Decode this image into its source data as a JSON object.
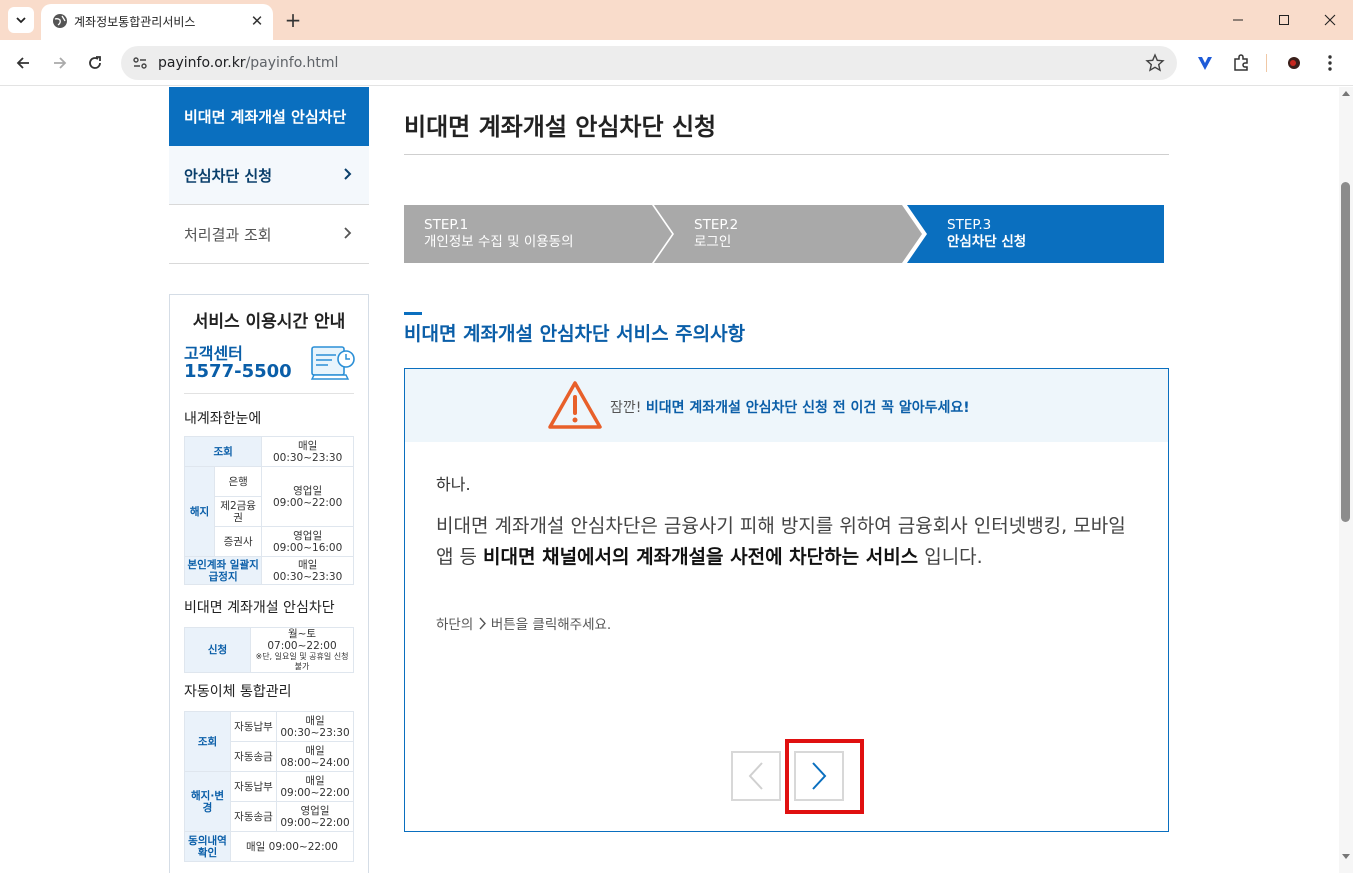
{
  "browser": {
    "tab_title": "계좌정보통합관리서비스",
    "url_host": "payinfo.or.kr",
    "url_path": "/payinfo.html"
  },
  "sidebar": {
    "header": "비대면 계좌개설 안심차단",
    "items": [
      {
        "label": "안심차단 신청",
        "active": true
      },
      {
        "label": "처리결과 조회",
        "active": false
      }
    ],
    "service_hours": {
      "title": "서비스 이용시간 안내",
      "cs_label": "고객센터",
      "cs_number": "1577-5500",
      "sections": {
        "my_account": "내계좌한눈에",
        "nonface": "비대면 계좌개설 안심차단",
        "autopay": "자동이체 통합관리"
      },
      "my_account_table": {
        "inquiry": "조회",
        "inquiry_time": "매일 00:30~23:30",
        "terminate": "해지",
        "bank": "은행",
        "second_fin": "제2금융권",
        "bank_time": "영업일 09:00~22:00",
        "securities": "증권사",
        "securities_time": "영업일 09:00~16:00",
        "suspend": "본인계좌 일괄지급정지",
        "suspend_time": "매일 00:30~23:30"
      },
      "nonface_table": {
        "apply": "신청",
        "apply_time": "월~토 07:00~22:00",
        "apply_note": "※단, 일요일 및 공휴일 신청 불가"
      },
      "autopay_table": {
        "inquiry": "조회",
        "auto_pay": "자동납부",
        "auto_send": "자동송금",
        "inq_pay_time": "매일 00:30~23:30",
        "inq_send_time": "매일 08:00~24:00",
        "change": "해지·변경",
        "chg_pay_time": "매일 09:00~22:00",
        "chg_send_time": "영업일 09:00~22:00",
        "consent": "동의내역 확인",
        "consent_time": "매일 09:00~22:00"
      }
    }
  },
  "main": {
    "title": "비대면 계좌개설 안심차단 신청",
    "steps": [
      {
        "num": "STEP.1",
        "name": "개인정보 수집 및 이용동의",
        "active": false
      },
      {
        "num": "STEP.2",
        "name": "로그인",
        "active": false
      },
      {
        "num": "STEP.3",
        "name": "안심차단 신청",
        "active": true
      }
    ],
    "notice_title": "비대면 계좌개설 안심차단 서비스 주의사항",
    "warning_prefix": "잠깐!",
    "warning_text": "비대면 계좌개설 안심차단 신청 전 이건 꼭 알아두세요!",
    "item_label": "하나.",
    "desc_part1": "비대면 계좌개설 안심차단은 금융사기 피해 방지를 위하여 금융회사 인터넷뱅킹, 모바일 앱 등",
    "desc_bold": "비대면 채널에서의 계좌개설을 사전에 차단하는 서비스",
    "desc_part2": "입니다.",
    "hint_prefix": "하단의",
    "hint_suffix": "버튼을 클릭해주세요."
  },
  "colors": {
    "primary": "#0a6fbf",
    "step_inactive": "#a9a9a9",
    "highlight": "#e01010",
    "warning": "#e8602a"
  }
}
